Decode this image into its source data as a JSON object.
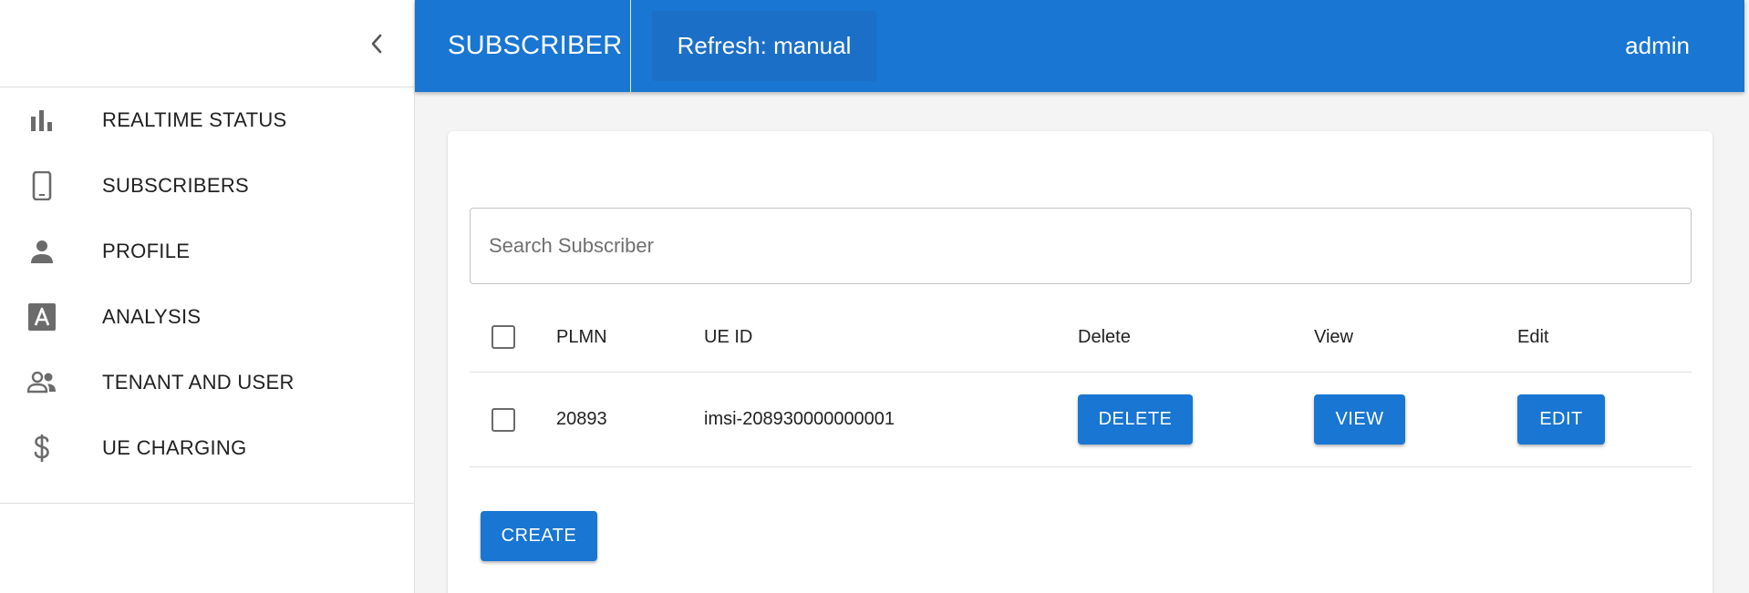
{
  "sidebar": {
    "items": [
      {
        "label": "REALTIME STATUS",
        "icon": "bar-chart-icon"
      },
      {
        "label": "SUBSCRIBERS",
        "icon": "phone-icon"
      },
      {
        "label": "PROFILE",
        "icon": "person-icon"
      },
      {
        "label": "ANALYSIS",
        "icon": "letter-a-icon"
      },
      {
        "label": "TENANT AND USER",
        "icon": "people-icon"
      },
      {
        "label": "UE CHARGING",
        "icon": "dollar-icon"
      }
    ]
  },
  "topbar": {
    "title": "SUBSCRIBER",
    "refresh_label": "Refresh: manual",
    "user": "admin"
  },
  "search": {
    "placeholder": "Search Subscriber",
    "value": ""
  },
  "table": {
    "headers": {
      "plmn": "PLMN",
      "ue_id": "UE ID",
      "delete": "Delete",
      "view": "View",
      "edit": "Edit"
    },
    "rows": [
      {
        "plmn": "20893",
        "ue_id": "imsi-208930000000001",
        "delete_label": "DELETE",
        "view_label": "VIEW",
        "edit_label": "EDIT"
      }
    ]
  },
  "actions": {
    "create_label": "CREATE"
  },
  "colors": {
    "primary": "#1976d2",
    "icon_gray": "#6b6b6b"
  }
}
